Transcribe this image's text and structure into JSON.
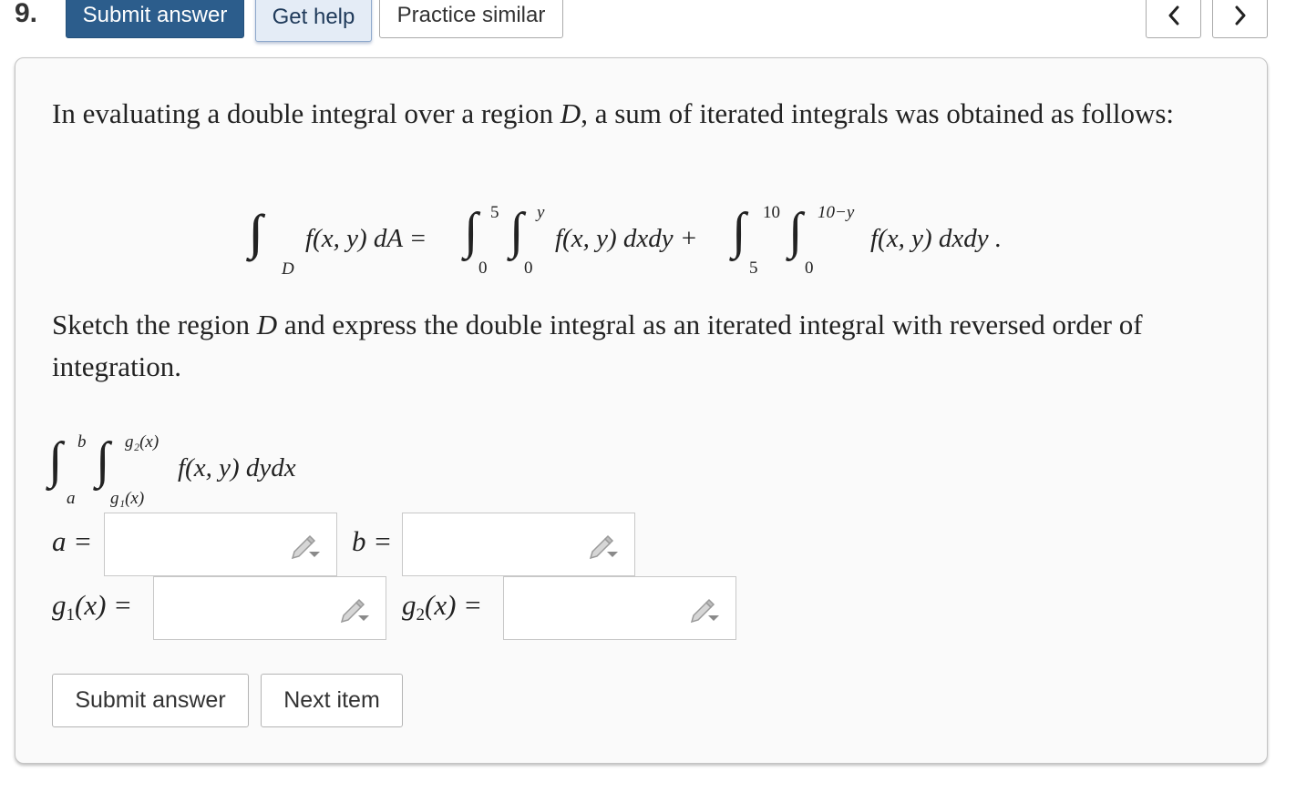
{
  "header": {
    "question_number": "9.",
    "submit_label": "Submit answer",
    "help_label": "Get help",
    "similar_label": "Practice similar",
    "prev_icon": "chevron-left-icon",
    "next_icon": "chevron-right-icon"
  },
  "question": {
    "intro_part1": "In evaluating a double integral over a region ",
    "intro_var": "D",
    "intro_part2": ", a sum of iterated integrals was obtained as follows:",
    "sketch_part1": "Sketch the region ",
    "sketch_var": "D",
    "sketch_part2": " and express the double integral as an iterated integral with reversed order of integration."
  },
  "equation": {
    "lhs_integrals": "∫∫",
    "lhs_region": "D",
    "lhs_integrand": "f(x, y) dA =",
    "term1_outer_upper": "5",
    "term1_outer_lower": "0",
    "term1_inner_upper": "y",
    "term1_inner_lower": "0",
    "term1_integrand": "f(x, y) dxdy +",
    "term2_outer_upper": "10",
    "term2_outer_lower": "5",
    "term2_inner_upper": "10−y",
    "term2_inner_lower": "0",
    "term2_integrand": "f(x, y) dxdy ."
  },
  "answer_template": {
    "outer_upper": "b",
    "outer_lower": "a",
    "inner_upper": "g₂(x)",
    "inner_lower": "g₁(x)",
    "integrand": "f(x, y) dydx"
  },
  "fields": {
    "a_label": "a =",
    "b_label": "b =",
    "g1_label_g": "g",
    "g1_label_sub": "1",
    "g1_label_rest": "(x) =",
    "g2_label_g": "g",
    "g2_label_sub": "2",
    "g2_label_rest": "(x) =",
    "a_value": "",
    "b_value": "",
    "g1_value": "",
    "g2_value": "",
    "edit_icon": "pencil-dropdown-icon"
  },
  "footer": {
    "submit_label": "Submit answer",
    "next_label": "Next item"
  },
  "colors": {
    "primary": "#2c5d8c",
    "help_bg": "#e4ecf6",
    "card_bg": "#fafafa"
  }
}
